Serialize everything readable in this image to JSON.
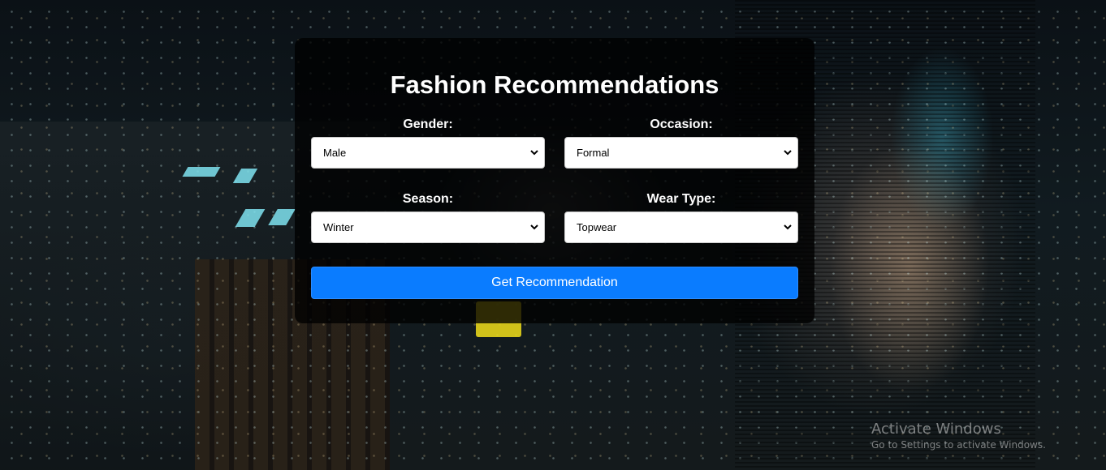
{
  "page": {
    "title": "Fashion Recommendations"
  },
  "form": {
    "gender": {
      "label": "Gender:",
      "value": "Male"
    },
    "occasion": {
      "label": "Occasion:",
      "value": "Formal"
    },
    "season": {
      "label": "Season:",
      "value": "Winter"
    },
    "wear_type": {
      "label": "Wear Type:",
      "value": "Topwear"
    },
    "submit_label": "Get Recommendation"
  },
  "watermark": {
    "title": "Activate Windows",
    "subtitle": "Go to Settings to activate Windows."
  },
  "colors": {
    "primary_button": "#0a7cff",
    "card_background": "rgba(0,0,0,0.78)"
  }
}
